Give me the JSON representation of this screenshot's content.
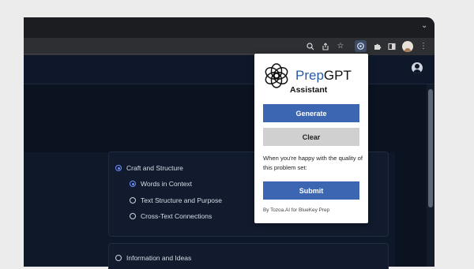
{
  "browser": {
    "toolbar_icons": [
      "zoom-icon",
      "share-icon",
      "star-icon",
      "extension-active-icon",
      "puzzle-icon",
      "sidepanel-icon",
      "profile-avatar",
      "menu-icon"
    ]
  },
  "page": {
    "options": [
      {
        "label": "Craft and Structure",
        "checked": true,
        "level": 0
      },
      {
        "label": "Words in Context",
        "checked": true,
        "level": 1
      },
      {
        "label": "Text Structure and Purpose",
        "checked": false,
        "level": 1
      },
      {
        "label": "Cross-Text Connections",
        "checked": false,
        "level": 1
      },
      {
        "label": "Information and Ideas",
        "checked": false,
        "level": 0
      }
    ]
  },
  "popup": {
    "brand_prep": "Prep",
    "brand_gpt": "GPT",
    "subtitle": "Assistant",
    "generate_label": "Generate",
    "clear_label": "Clear",
    "note": "When you're happy with the quality of this problem set:",
    "submit_label": "Submit",
    "footer": "By Tozoa.AI for BlueKey Prep"
  },
  "colors": {
    "accent": "#3c66b1",
    "brand_blue": "#2b5aa5",
    "radio_checked": "#6d8dff",
    "page_bg": "#0c1424"
  }
}
